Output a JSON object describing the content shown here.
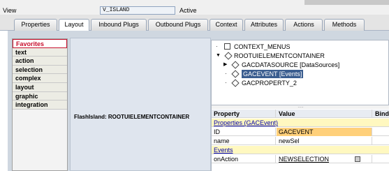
{
  "header": {
    "view_label": "View",
    "view_value": "V_ISLAND",
    "status": "Active"
  },
  "tabs": [
    {
      "label": "Properties"
    },
    {
      "label": "Layout",
      "active": true
    },
    {
      "label": "Inbound Plugs"
    },
    {
      "label": "Outbound Plugs"
    },
    {
      "label": "Context"
    },
    {
      "label": "Attributes"
    },
    {
      "label": "Actions"
    },
    {
      "label": "Methods"
    }
  ],
  "palette": {
    "items": [
      "Favorites",
      "text",
      "action",
      "selection",
      "complex",
      "layout",
      "graphic",
      "integration"
    ],
    "selected": "Favorites"
  },
  "canvas": {
    "label": "FlashIsland: ROOTUIELEMENTCONTAINER"
  },
  "tree": {
    "nodes": [
      {
        "label": "CONTEXT_MENUS"
      },
      {
        "label": "ROOTUIELEMENTCONTAINER"
      },
      {
        "label": "GACDATASOURCE  [DataSources]"
      },
      {
        "label": "GACEVENT  [Events]",
        "selected": true
      },
      {
        "label": "GACPROPERTY_2"
      }
    ]
  },
  "properties": {
    "columns": [
      "Property",
      "Value",
      "Bindi..."
    ],
    "section_properties": "Properties (GACEvent)",
    "rows": [
      {
        "property": "ID",
        "value": "GACEVENT"
      },
      {
        "property": "name",
        "value": "newSel"
      }
    ],
    "section_events": "Events",
    "events": [
      {
        "property": "onAction",
        "value": "NEWSELECTION"
      }
    ]
  },
  "colors": {
    "selected_palette": "#c8102e",
    "tree_selection": "#3a5d8f",
    "highlight": "#ffd07a",
    "section_bg": "#fff8c0"
  }
}
